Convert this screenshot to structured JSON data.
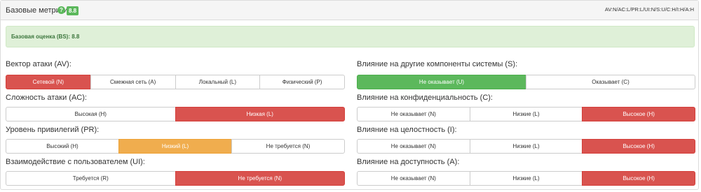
{
  "header": {
    "title": "Базовые метрики",
    "help_icon": "?",
    "score": "8.8",
    "vector": "AV:N/AC:L/PR:L/UI:N/S:U/C:H/I:H/A:H"
  },
  "alert": {
    "text": "Базовая оценка (BS): 8.8"
  },
  "colors": {
    "selected_red": "#d9534f",
    "selected_green": "#5cb85c",
    "selected_orange": "#f0ad4e",
    "alert_bg": "#dff0d8"
  },
  "metrics": [
    {
      "id": "av",
      "label": "Вектор атаки (AV):",
      "options": [
        {
          "label": "Сетевой (N)",
          "selected": "red"
        },
        {
          "label": "Смежная сеть (A)",
          "selected": ""
        },
        {
          "label": "Локальный (L)",
          "selected": ""
        },
        {
          "label": "Физический (P)",
          "selected": ""
        }
      ]
    },
    {
      "id": "ac",
      "label": "Сложность атаки (AC):",
      "options": [
        {
          "label": "Высокая (H)",
          "selected": ""
        },
        {
          "label": "Низкая (L)",
          "selected": "red"
        }
      ]
    },
    {
      "id": "pr",
      "label": "Уровень привилегий (PR):",
      "options": [
        {
          "label": "Высокий (H)",
          "selected": ""
        },
        {
          "label": "Низкий (L)",
          "selected": "orange"
        },
        {
          "label": "Не требуется (N)",
          "selected": ""
        }
      ]
    },
    {
      "id": "ui",
      "label": "Взаимодействие с пользователем (UI):",
      "options": [
        {
          "label": "Требуется (R)",
          "selected": ""
        },
        {
          "label": "Не требуется (N)",
          "selected": "red"
        }
      ]
    },
    {
      "id": "s",
      "label": "Влияние на другие компоненты системы (S):",
      "options": [
        {
          "label": "Не оказывает (U)",
          "selected": "green"
        },
        {
          "label": "Оказывает (C)",
          "selected": ""
        }
      ]
    },
    {
      "id": "c",
      "label": "Влияние на конфиденциальность (C):",
      "options": [
        {
          "label": "Не оказывает (N)",
          "selected": ""
        },
        {
          "label": "Низкие (L)",
          "selected": ""
        },
        {
          "label": "Высокое (H)",
          "selected": "red"
        }
      ]
    },
    {
      "id": "i",
      "label": "Влияние на целостность (I):",
      "options": [
        {
          "label": "Не оказывает (N)",
          "selected": ""
        },
        {
          "label": "Низкие (L)",
          "selected": ""
        },
        {
          "label": "Высокое (H)",
          "selected": "red"
        }
      ]
    },
    {
      "id": "a",
      "label": "Влияние на доступность (A):",
      "options": [
        {
          "label": "Не оказывает (N)",
          "selected": ""
        },
        {
          "label": "Низкие (L)",
          "selected": ""
        },
        {
          "label": "Высокое (H)",
          "selected": "red"
        }
      ]
    }
  ]
}
